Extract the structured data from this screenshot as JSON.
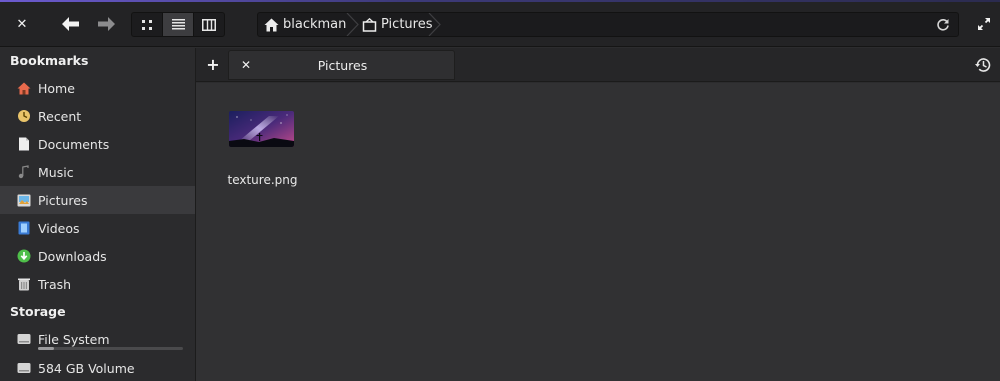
{
  "window": {
    "accent": "#6c5bd0"
  },
  "toolbar": {
    "close_icon": "close-icon",
    "back_icon": "arrow-left-icon",
    "forward_icon": "arrow-right-icon",
    "view_modes": [
      "icon-view",
      "list-view",
      "column-view"
    ],
    "active_view": "list-view",
    "refresh_icon": "refresh-icon",
    "maximize_icon": "maximize-icon"
  },
  "path": {
    "crumbs": [
      {
        "icon": "home-icon",
        "label": "blackman"
      },
      {
        "icon": "pictures-folder-icon",
        "label": "Pictures"
      }
    ]
  },
  "sidebar": {
    "bookmarks_title": "Bookmarks",
    "items": [
      {
        "icon": "home-icon",
        "label": "Home"
      },
      {
        "icon": "recent-icon",
        "label": "Recent"
      },
      {
        "icon": "document-icon",
        "label": "Documents"
      },
      {
        "icon": "music-icon",
        "label": "Music"
      },
      {
        "icon": "pictures-icon",
        "label": "Pictures",
        "selected": true
      },
      {
        "icon": "videos-icon",
        "label": "Videos"
      },
      {
        "icon": "downloads-icon",
        "label": "Downloads"
      },
      {
        "icon": "trash-icon",
        "label": "Trash"
      }
    ],
    "storage_title": "Storage",
    "storage": [
      {
        "icon": "drive-icon",
        "label": "File System",
        "usage_fraction": 0.11
      },
      {
        "icon": "drive-icon",
        "label": "584 GB Volume"
      }
    ]
  },
  "tabs": {
    "new_tab_label": "+",
    "items": [
      {
        "label": "Pictures"
      }
    ],
    "history_icon": "history-icon"
  },
  "content": {
    "files": [
      {
        "name": "texture.png",
        "kind": "image"
      }
    ]
  }
}
